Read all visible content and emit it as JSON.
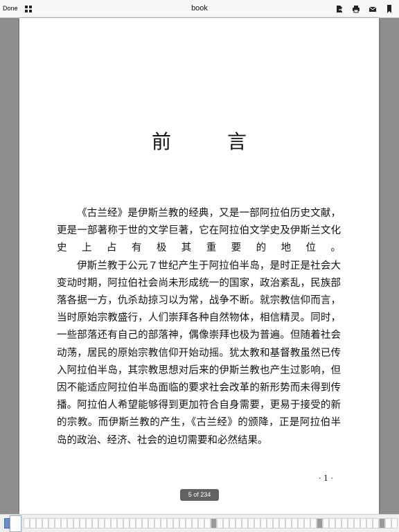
{
  "toolbar": {
    "done_label": "Done",
    "title": "book",
    "icons": [
      "grid-icon",
      "export-icon",
      "print-icon",
      "mail-icon",
      "bookmark-icon"
    ]
  },
  "page": {
    "heading": "前 言",
    "paragraphs": [
      "《古兰经》是伊斯兰教的经典，又是一部阿拉伯历史文献，更是一部著称于世的文学巨著，它在阿拉伯文学史及伊斯兰文化史上占有极其重要的地位。",
      "伊斯兰教于公元７世纪产生于阿拉伯半岛，是时正是社会大变动时期，阿拉伯社会尚未形成统一的国家，政治紊乱，民族部落各据一方，仇杀劫掠习以为常，战争不断。就宗教信仰而言，当时原始宗教盛行，人们崇拜各种自然物体，相信精灵。同时，一些部落还有自己的部落神，偶像崇拜也极为普遍。但随着社会动荡，居民的原始宗教信仰开始动摇。犹太教和基督教虽然已传入阿拉伯半岛，其宗教思想对后来的伊斯兰教也产生过影响，但因不能适应阿拉伯半岛面临的要求社会改革的新形势而未得到传播。阿拉伯人希望能够得到更加符合自身需要，更易于接受的新的宗教。而伊斯兰教的产生，《古兰经》的颁降，正是阿拉伯半岛的政治、经济、社会的迫切需要和必然结果。"
    ],
    "page_number": "· 1 ·"
  },
  "page_counter": "5 of 234",
  "thumbnails": {
    "count": 62,
    "current_index": 0
  },
  "colors": {
    "toolbar_bg": "#f7f7f7",
    "canvas_bg": "#8e8e8e",
    "page_bg": "#ffffff",
    "accent": "#6e8bc2"
  }
}
